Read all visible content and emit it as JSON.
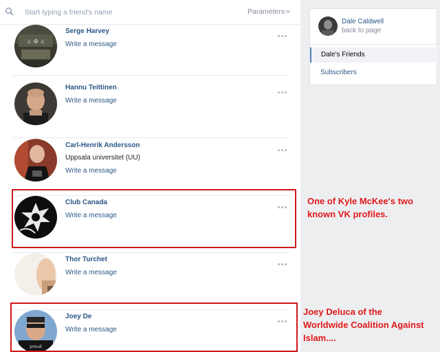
{
  "search": {
    "placeholder": "Start typing a friend's name",
    "parameters_label": "Parameters"
  },
  "friends": [
    {
      "name": "Serge Harvey",
      "subtitle": "",
      "action": "Write a message"
    },
    {
      "name": "Hannu Teittinen",
      "subtitle": "",
      "action": "Write a message"
    },
    {
      "name": "Carl-Henrik Andersson",
      "subtitle": "Uppsala universitet (UU)",
      "action": "Write a message"
    },
    {
      "name": "Club Canada",
      "subtitle": "",
      "action": "Write a message"
    },
    {
      "name": "Thor Turchet",
      "subtitle": "",
      "action": "Write a message"
    },
    {
      "name": "Joey De",
      "subtitle": "",
      "action": "Write a message"
    }
  ],
  "annotations": {
    "club_canada_note_line1": "One of Kyle McKee's two",
    "club_canada_note_line2": "known VK profiles.",
    "joey_note_line1": "Joey Deluca of the",
    "joey_note_line2": "Worldwide Coalition Against",
    "joey_note_line3": "Islam....",
    "highlight_color": "#d0151a",
    "note_color": "#e01a1a"
  },
  "sidebar": {
    "profile_name": "Dale Caldwell",
    "back_label": "back to page",
    "tabs": [
      {
        "label": "Dale's Friends",
        "active": true
      },
      {
        "label": "Subscribers",
        "active": false
      }
    ]
  },
  "colors": {
    "link": "#2a5885",
    "muted": "#828a99",
    "page_bg": "#edeef0",
    "accent": "#5181b8"
  },
  "icons": {
    "search": "search-icon",
    "chevron": "chevron-down-icon",
    "more": "more-dots-icon"
  }
}
